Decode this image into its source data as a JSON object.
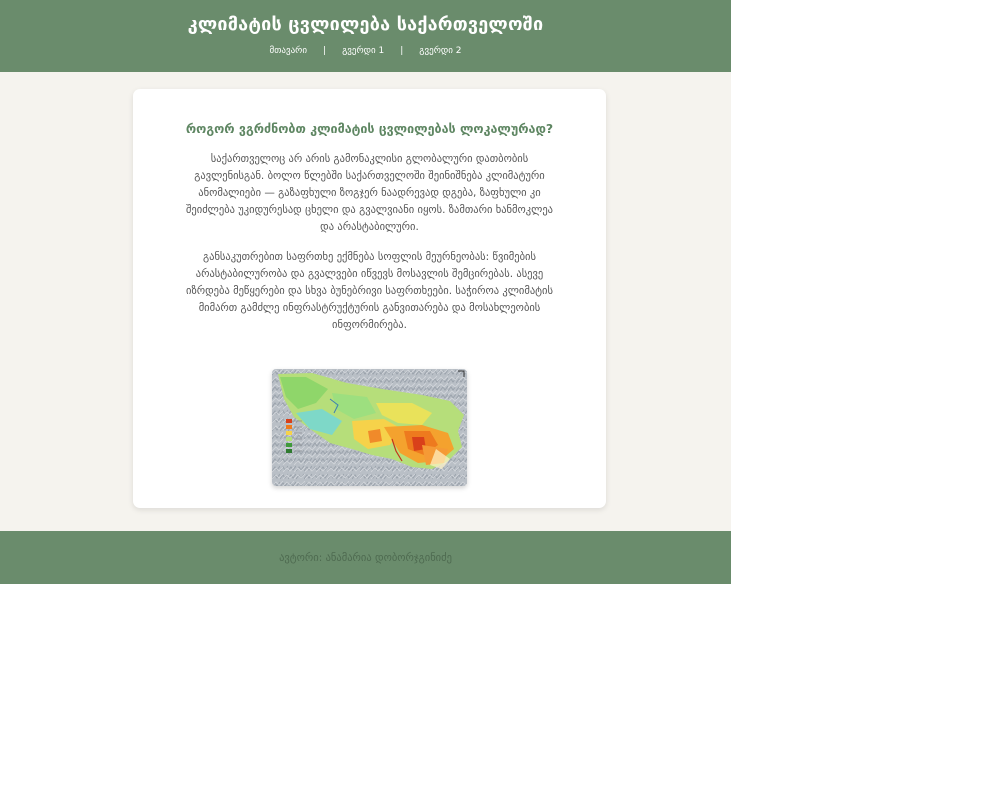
{
  "header": {
    "title": "კლიმატის ცვლილება საქართველოში",
    "nav": [
      {
        "label": "მთავარი"
      },
      {
        "label": "გვერდი 1"
      },
      {
        "label": "გვერდი 2"
      }
    ],
    "separator": "|"
  },
  "article": {
    "heading": "როგორ ვგრძნობთ კლიმატის ცვლილებას ლოკალურად?",
    "paragraphs": [
      "საქართველოც არ არის გამონაკლისი გლობალური დათბობის გავლენისგან. ბოლო წლებში საქართველოში შეინიშნება კლიმატური ანომალიები — გაზაფხული ზოგჯერ ნაადრევად დგება, ზაფხული კი შეიძლება უკიდურესად ცხელი და გვალვიანი იყოს. ზამთარი ხანმოკლეა და არასტაბილური.",
      "განსაკუთრებით საფრთხე ექმნება სოფლის მეურნეობას: წვიმების არასტაბილურობა და გვალვები იწვევს მოსავლის შემცირებას. ასევე იზრდება მეწყერები და სხვა ბუნებრივი საფრთხეები. საჭიროა კლიმატის მიმართ გამძლე ინფრასტრუქტურის განვითარება და მოსახლეობის ინფორმირება."
    ]
  },
  "footer": {
    "text": "ავტორი: ანამარია დობორჯგინიძე"
  },
  "colors": {
    "header_bg": "#6a8c6c",
    "page_bg": "#f5f3ee",
    "heading": "#5e8662",
    "body_text": "#555555",
    "footer_text": "#4e6a50"
  },
  "icons": [
    "map-image"
  ]
}
